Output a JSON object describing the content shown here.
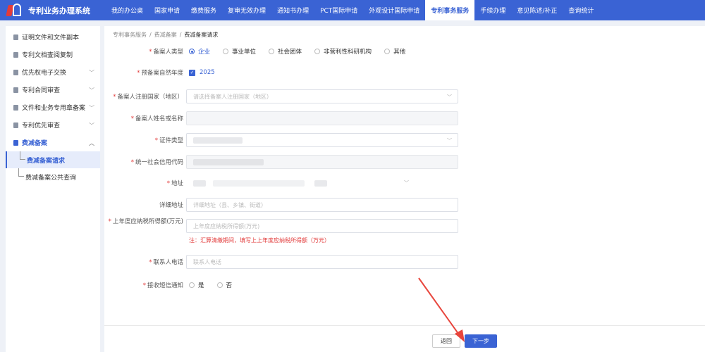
{
  "app": {
    "title": "专利业务办理系统"
  },
  "nav": {
    "items": [
      {
        "label": "我的办公桌"
      },
      {
        "label": "国家申请"
      },
      {
        "label": "缴费服务"
      },
      {
        "label": "复审无效办理"
      },
      {
        "label": "通知书办理"
      },
      {
        "label": "PCT国际申请"
      },
      {
        "label": "外观设计国际申请"
      },
      {
        "label": "专利事务服务",
        "active": true
      },
      {
        "label": "手续办理"
      },
      {
        "label": "意见陈述/补正"
      },
      {
        "label": "查询统计"
      }
    ]
  },
  "sidebar": {
    "items": [
      {
        "label": "证明文件和文件副本"
      },
      {
        "label": "专利文档查阅复制"
      },
      {
        "label": "优先权电子交换",
        "chevron": "﹀"
      },
      {
        "label": "专利合同审查",
        "chevron": "﹀"
      },
      {
        "label": "文件和业务专用章备案",
        "chevron": "﹀"
      },
      {
        "label": "专利优先审查",
        "chevron": "﹀"
      },
      {
        "label": "费减备案",
        "chevron": "︿"
      }
    ],
    "subitems": [
      {
        "label": "费减备案请求",
        "active": true
      },
      {
        "label": "费减备案公共查询"
      }
    ]
  },
  "breadcrumb": {
    "items": [
      "专利事务服务",
      "费减备案",
      "费减备案请求"
    ],
    "sep": "/"
  },
  "form": {
    "filer_type": {
      "label": "备案人类型",
      "options": [
        "企业",
        "事业单位",
        "社会团体",
        "非营利性科研机构",
        "其他"
      ],
      "selected": "企业"
    },
    "year": {
      "label": "预备案自然年度",
      "value": "2025"
    },
    "country": {
      "label": "备案人注册国家（地区）",
      "placeholder": "请选择备案人注册国家（地区）"
    },
    "name": {
      "label": "备案人姓名或名称"
    },
    "id_type": {
      "label": "证件类型"
    },
    "credit_code": {
      "label": "统一社会信用代码"
    },
    "address": {
      "label": "地址"
    },
    "detail_address": {
      "label": "详细地址",
      "placeholder": "详细地址（县、乡镇、街道）"
    },
    "income": {
      "label": "上年度应纳税所得额(万元)",
      "placeholder": "上年度应纳税所得额(万元)",
      "note": "注：汇算清缴期间，填写上上年度应纳税所得额（万元）"
    },
    "phone": {
      "label": "联系人电话",
      "placeholder": "联系人电话"
    },
    "sms": {
      "label": "接收短信通知",
      "options": [
        "是",
        "否"
      ]
    }
  },
  "footer": {
    "back_label": "返回",
    "next_label": "下一步"
  },
  "colors": {
    "brand": "#3a63d4",
    "required": "#e23b3b",
    "annotation_arrow": "#e8453c"
  }
}
